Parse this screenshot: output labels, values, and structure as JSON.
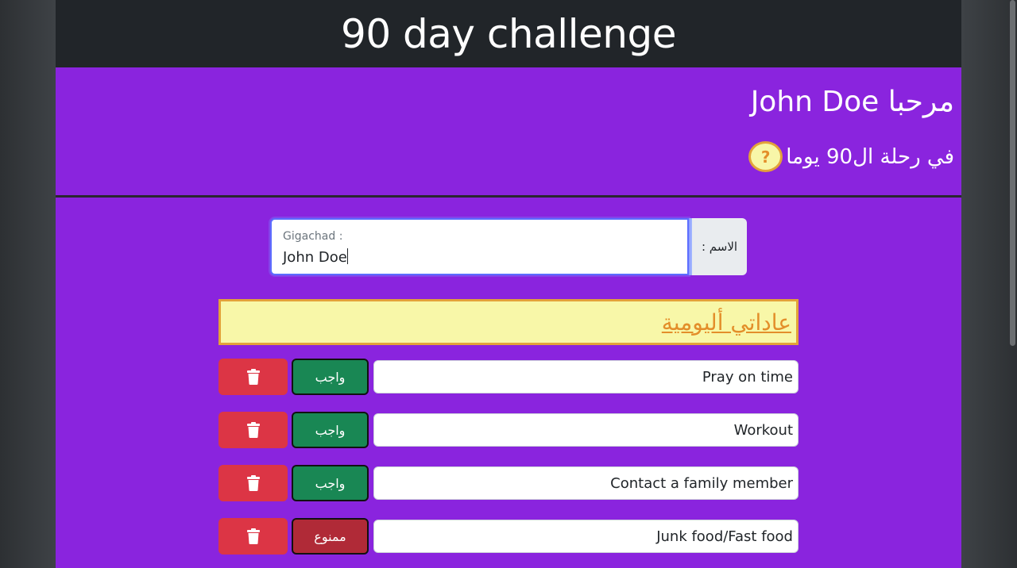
{
  "app": {
    "title": "90 day challenge"
  },
  "greeting": {
    "text": "مرحبا John Doe"
  },
  "journey": {
    "text": "في رحلة ال90 يوما",
    "help_label": "?"
  },
  "name_form": {
    "addon_label": "الاسم :",
    "field_label": "Gigachad :",
    "value": "John Doe"
  },
  "habits": {
    "header": "عاداتي أليومية",
    "items": [
      {
        "text": "Pray on time",
        "state_label": "واجب",
        "state": "must"
      },
      {
        "text": "Workout",
        "state_label": "واجب",
        "state": "must"
      },
      {
        "text": "Contact a family member",
        "state_label": "واجب",
        "state": "must"
      },
      {
        "text": "Junk food/Fast food",
        "state_label": "ممنوع",
        "state": "forbidden"
      }
    ]
  },
  "colors": {
    "navbar": "#212529",
    "background": "#8a24de",
    "header_fill": "#f8f7a8",
    "header_accent": "#e38e2a",
    "delete": "#dc3545",
    "must": "#198754",
    "forbidden": "#b02a37"
  },
  "icons": {
    "delete": "trash-icon",
    "help": "question-icon"
  }
}
